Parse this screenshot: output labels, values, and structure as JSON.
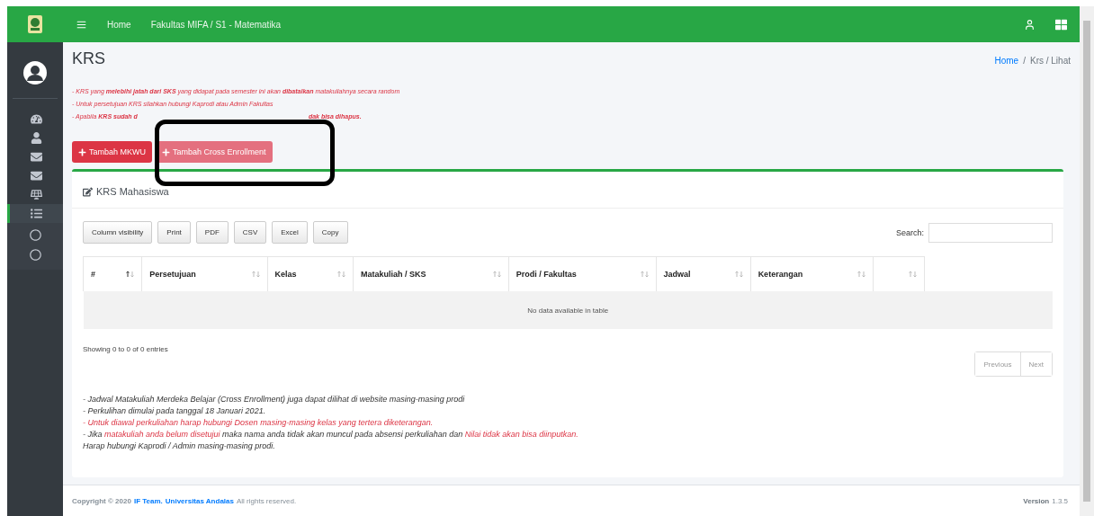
{
  "topbar": {
    "nav": [
      "Home",
      "Fakultas MIFA / S1 - Matematika"
    ]
  },
  "sidebar": {
    "items": [
      {
        "selected": false
      },
      {
        "selected": false
      },
      {
        "selected": false
      },
      {
        "selected": false
      },
      {
        "selected": false
      },
      {
        "selected": true
      }
    ]
  },
  "page": {
    "title": "KRS",
    "breadcrumb": [
      {
        "label": "Home",
        "link": true
      },
      {
        "label": "/",
        "link": false
      },
      {
        "label": "Krs / Lihat",
        "link": false
      }
    ]
  },
  "notices": [
    {
      "parts": [
        "- KRS yang **melebihi jatah dari SKS** yang didapat pada semester ini akan **dibatalkan** matakuliahnya secara random"
      ]
    },
    {
      "parts": [
        "- Untuk persetujuan KRS silahkan hubungi Kaprodi atau Admin Fakultas"
      ]
    },
    {
      "parts": [
        "- Apabila **KRS sudah d**",
        "**dak bisa dihapus.**"
      ]
    }
  ],
  "actions": [
    {
      "label": "Tambah MKWU",
      "kind": "primary"
    },
    {
      "label": "Tambah Cross Enrollment",
      "kind": "light"
    }
  ],
  "annotation": {
    "kind": "frame"
  },
  "card": {
    "title": "KRS Mahasiswa",
    "export_buttons": [
      "Column visibility",
      "Print",
      "PDF",
      "CSV",
      "Excel",
      "Copy"
    ],
    "search": {
      "label": "Search:"
    },
    "table": {
      "columns": [
        {
          "label": "#",
          "sorted": true
        },
        {
          "label": "Persetujuan",
          "sorted": false
        },
        {
          "label": "Kelas",
          "sorted": false
        },
        {
          "label": "Matakuliah / SKS",
          "sorted": false
        },
        {
          "label": "Prodi / Fakultas",
          "sorted": false
        },
        {
          "label": "Jadwal",
          "sorted": false
        },
        {
          "label": "Keterangan",
          "sorted": false
        },
        {
          "sorted": false
        }
      ],
      "empty_message": "No data available in table"
    },
    "info": "Showing 0 to 0 of 0 entries",
    "pagination": [
      {
        "label": "Previous",
        "disabled": true
      },
      {
        "label": "Next",
        "disabled": true
      }
    ],
    "notes": [
      [
        {
          "text": "- Jadwal Matakuliah Merdeka Belajar (Cross Enrollment) juga dapat dilihat di website masing-masing prodi",
          "emphasis": false
        }
      ],
      [
        {
          "text": "- Perkulihan dimulai pada tanggal 18 Januari 2021.",
          "emphasis": false
        }
      ],
      [
        {
          "text": "- Untuk diawal perkuliahan harap hubungi Dosen masing-masing kelas yang tertera diketerangan.",
          "emphasis": true
        }
      ],
      [
        {
          "text": "- Jika ",
          "emphasis": false
        },
        {
          "text": "matakuliah anda belum disetujui",
          "emphasis": true
        },
        {
          "text": " maka nama anda tidak akan muncul pada absensi perkuliahan dan ",
          "emphasis": false
        },
        {
          "text": "Nilai tidak akan bisa diinputkan.",
          "emphasis": true
        }
      ],
      [
        {
          "text": "Harap hubungi Kaprodi / Admin masing-masing prodi.",
          "emphasis": false
        }
      ]
    ]
  },
  "footer": {
    "copyright": "Copyright © 2020",
    "team": "IF Team.",
    "university": "Universitas Andalas",
    "rights": "All rights reserved.",
    "version_label": "Version",
    "version": "1.3.5"
  }
}
